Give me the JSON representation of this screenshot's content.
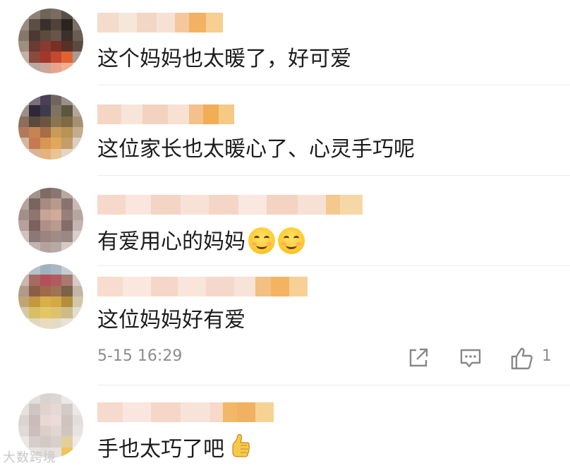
{
  "comments": [
    {
      "text": "这个妈妈也太暖了，好可爱"
    },
    {
      "text": "这位家长也太暖心了、心灵手巧呢"
    },
    {
      "text": "有爱用心的妈妈"
    },
    {
      "text": "这位妈妈好有爱",
      "timestamp": "5-15 16:29",
      "like_count": "1"
    },
    {
      "text": "手也太巧了吧"
    }
  ],
  "icons": {
    "share": "share-icon",
    "reply": "comment-icon",
    "like": "thumbs-up-icon",
    "smile_emoji": "smile-emoji-icon",
    "thumb_emoji": "thumbs-up-emoji-icon"
  },
  "watermark": "大数跨境",
  "colors": {
    "text": "#1c1c1c",
    "meta": "#8d8d8d",
    "divider": "#ececec",
    "name_highlight": "#f4b85c"
  }
}
